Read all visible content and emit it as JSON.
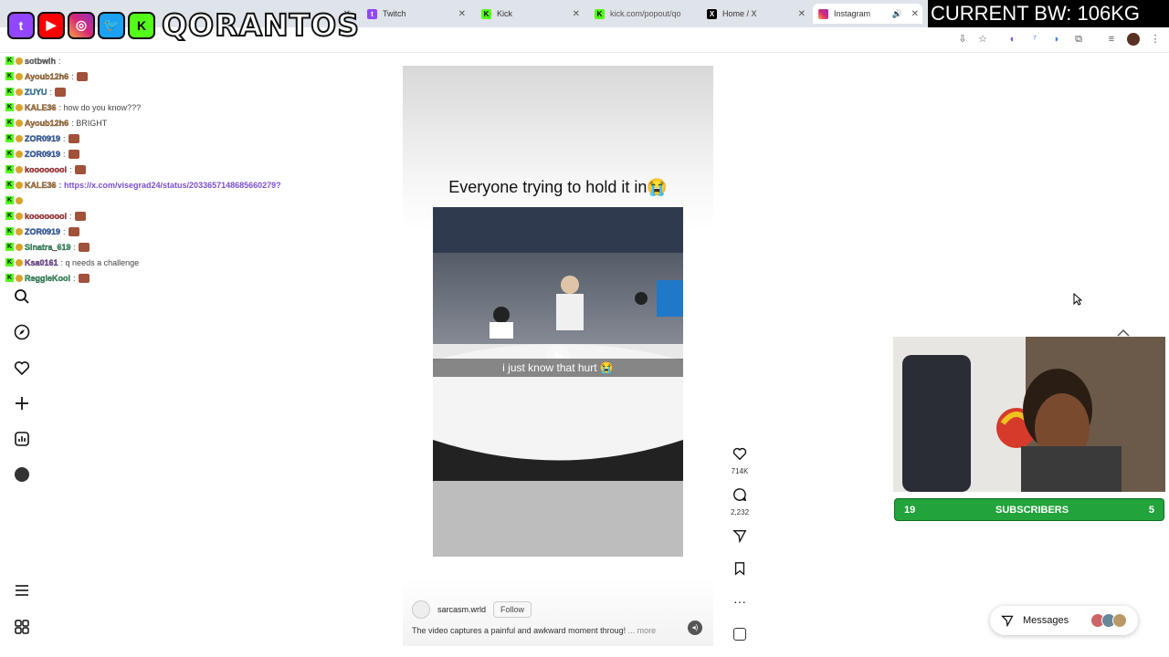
{
  "browser": {
    "tabs": [
      {
        "label": "",
        "icon": "chat-icon",
        "active": false
      },
      {
        "label": "Twitch",
        "icon": "twitch-icon",
        "active": false
      },
      {
        "label": "Kick",
        "icon": "kick-icon",
        "active": false
      },
      {
        "label": "kick.com/popout/qo",
        "icon": "kick-icon",
        "active": false
      },
      {
        "label": "Home / X",
        "icon": "x-icon",
        "active": false
      },
      {
        "label": "Instagram",
        "icon": "instagram-icon",
        "active": true
      }
    ]
  },
  "overlay": {
    "logo_text": "QORANTOS",
    "bw_label": "CURRENT BW: 106KG",
    "subs_left": "19",
    "subs_label": "SUBSCRIBERS",
    "subs_right": "5"
  },
  "chat": [
    {
      "user": "sotbwih",
      "color": "#8a8a8a",
      "msg": ":",
      "emote": false
    },
    {
      "user": "Ayoub12h6",
      "color": "#d98b3a",
      "msg": ":",
      "emote": true
    },
    {
      "user": "ZUYU",
      "color": "#3aa0e0",
      "msg": ":",
      "emote": true
    },
    {
      "user": "KALE36",
      "color": "#d98b3a",
      "msg": ": how do you know???",
      "emote": false
    },
    {
      "user": "Ayoub12h6",
      "color": "#d98b3a",
      "msg": ": BRIGHT",
      "emote": false
    },
    {
      "user": "ZOR0919",
      "color": "#3a7ae0",
      "msg": ":",
      "emote": true
    },
    {
      "user": "ZOR0919",
      "color": "#3a7ae0",
      "msg": ":",
      "emote": true
    },
    {
      "user": "koooooool",
      "color": "#e03a3a",
      "msg": ":",
      "emote": true
    },
    {
      "user": "KALE36",
      "color": "#d98b3a",
      "msg": ": https://x.com/visegrad24/status/2033657148685660279?",
      "emote": false,
      "link": true
    },
    {
      "user": "",
      "color": "#8a8a8a",
      "msg": "",
      "emote": false
    },
    {
      "user": "koooooool",
      "color": "#e03a3a",
      "msg": ":",
      "emote": true
    },
    {
      "user": "ZOR0919",
      "color": "#3a7ae0",
      "msg": ":",
      "emote": true
    },
    {
      "user": "Sinatra_619",
      "color": "#3ac07a",
      "msg": ":",
      "emote": true
    },
    {
      "user": "Ksa0161",
      "color": "#9a5ad0",
      "msg": ": q needs a challenge",
      "emote": false
    },
    {
      "user": "ReggieKool",
      "color": "#3ac07a",
      "msg": ":",
      "emote": true
    }
  ],
  "instagram": {
    "nav_icons": [
      "search-icon",
      "explore-icon",
      "heart-icon",
      "create-icon",
      "dashboard-icon",
      "profile-icon",
      "menu-icon",
      "apps-icon"
    ],
    "reel": {
      "caption": "Everyone trying to hold it in😭",
      "video_text": "i just know that hurt 😭",
      "author": "sarcasm.wrld",
      "follow_label": "Follow",
      "description": "The video captures a painful and awkward moment throug!",
      "more_label": "... more",
      "likes": "714K",
      "comments": "2,232"
    },
    "messages_label": "Messages"
  },
  "colors": {
    "kick_green": "#53fc18",
    "subs_green": "#22a33b"
  }
}
